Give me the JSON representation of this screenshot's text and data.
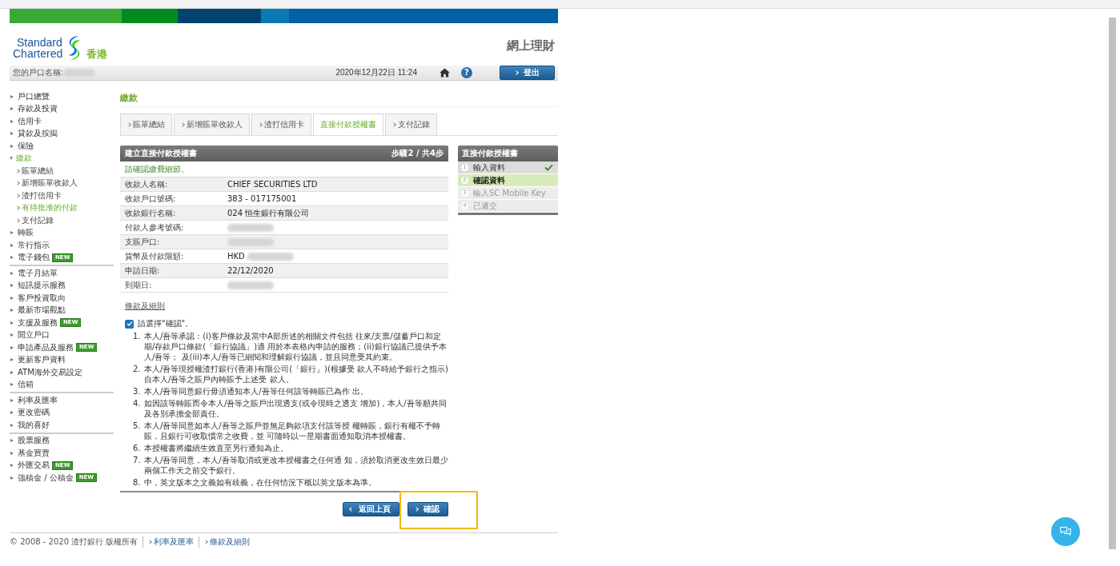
{
  "header": {
    "brand_line1": "Standard",
    "brand_line2": "Chartered",
    "region": "香港",
    "service_title": "網上理財"
  },
  "account_bar": {
    "account_label": "您的戶口名稱:",
    "datetime": "2020年12月22日 11:24",
    "help": "?",
    "logout": "登出"
  },
  "sidebar": {
    "groups": [
      {
        "items": [
          {
            "label": "戶口總覽",
            "selected": false,
            "expanded": false
          },
          {
            "label": "存款及投資",
            "selected": false,
            "expanded": false
          },
          {
            "label": "信用卡",
            "selected": false,
            "expanded": false
          },
          {
            "label": "貸款及按揭",
            "selected": false,
            "expanded": false
          },
          {
            "label": "保險",
            "selected": false,
            "expanded": false
          },
          {
            "label": "繳款",
            "selected": true,
            "expanded": true,
            "children": [
              {
                "label": "賬單總結",
                "selected": false
              },
              {
                "label": "新增賬單收款人",
                "selected": false
              },
              {
                "label": "渣打信用卡",
                "selected": false
              },
              {
                "label": "有待批准的付款",
                "selected": true
              },
              {
                "label": "支付記錄",
                "selected": false
              }
            ]
          },
          {
            "label": "轉賬",
            "selected": false,
            "expanded": false
          },
          {
            "label": "常行指示",
            "selected": false,
            "expanded": false
          },
          {
            "label": "電子錢包",
            "selected": false,
            "expanded": false,
            "badge": "NEW"
          }
        ]
      },
      {
        "items": [
          {
            "label": "電子月結單",
            "selected": false,
            "expanded": false
          },
          {
            "label": "短訊提示服務",
            "selected": false,
            "expanded": false
          },
          {
            "label": "客戶投資取向",
            "selected": false,
            "expanded": false
          },
          {
            "label": "最新市場觀點",
            "selected": false,
            "expanded": false
          },
          {
            "label": "支援及服務",
            "selected": false,
            "expanded": false,
            "badge": "NEW"
          },
          {
            "label": "開立戶口",
            "selected": false,
            "expanded": false
          },
          {
            "label": "申請產品及服務",
            "selected": false,
            "expanded": false,
            "badge": "NEW"
          },
          {
            "label": "更新客戶資料",
            "selected": false,
            "expanded": false
          },
          {
            "label": "ATM海外交易設定",
            "selected": false,
            "expanded": false
          },
          {
            "label": "信箱",
            "selected": false,
            "expanded": false
          }
        ]
      },
      {
        "items": [
          {
            "label": "利率及匯率",
            "selected": false,
            "expanded": false
          },
          {
            "label": "更改密碼",
            "selected": false,
            "expanded": false
          },
          {
            "label": "我的喜好",
            "selected": false,
            "expanded": false
          }
        ]
      },
      {
        "items": [
          {
            "label": "股票服務",
            "selected": false,
            "expanded": false
          },
          {
            "label": "基金買賣",
            "selected": false,
            "expanded": false
          },
          {
            "label": "外匯交易",
            "selected": false,
            "expanded": false,
            "badge": "NEW"
          },
          {
            "label": "強積金 / 公積金",
            "selected": false,
            "expanded": false,
            "badge": "NEW"
          }
        ]
      }
    ]
  },
  "page_title": "繳款",
  "tabs": [
    {
      "label": "賬單總結",
      "selected": false
    },
    {
      "label": "新增賬單收款人",
      "selected": false
    },
    {
      "label": "渣打信用卡",
      "selected": false
    },
    {
      "label": "直接付款授權書",
      "selected": true
    },
    {
      "label": "支付記錄",
      "selected": false
    }
  ],
  "details": {
    "title": "建立直接付款授權書",
    "step": "步驟2 / 共4步",
    "prompt": "請確認繳費細節。",
    "rows": [
      {
        "label": "收款人名稱:",
        "value": "CHIEF SECURITIES LTD",
        "redacted": false
      },
      {
        "label": "收款戶口號碼:",
        "value": "383 - 017175001",
        "redacted": false
      },
      {
        "label": "收款銀行名稱:",
        "value": "024 恒生銀行有限公司",
        "redacted": false
      },
      {
        "label": "付款人參考號碼:",
        "redacted": true
      },
      {
        "label": "支賬戶口:",
        "redacted": true
      },
      {
        "label": "貨幣及付款限額:",
        "value": "HKD",
        "redacted": true
      },
      {
        "label": "申請日期:",
        "value": "22/12/2020",
        "redacted": false
      },
      {
        "label": "到期日:",
        "redacted": true
      }
    ]
  },
  "steps_panel": {
    "title": "直接付款授權書",
    "steps": [
      {
        "number": "1",
        "label": "輸入資料",
        "checked": true,
        "selected": false,
        "disabled": false
      },
      {
        "number": "2",
        "label": "確認資料",
        "checked": false,
        "selected": true,
        "disabled": false
      },
      {
        "number": "3",
        "label": "輸入SC Mobile Key",
        "checked": false,
        "selected": false,
        "disabled": true
      },
      {
        "number": "4",
        "label": "已遞交",
        "checked": false,
        "selected": false,
        "disabled": true
      }
    ]
  },
  "terms": {
    "heading": "條款及細則",
    "confirm_label": "請選擇\"確認\"。",
    "checked": true,
    "clauses": [
      {
        "number": "1.",
        "text": "本人/吾等承認：(i)客戶條款及當中A部所述的相關文件包括 往來/支票/儲蓄戶口和定期/存款戶口條款(「銀行協議」)適 用於本表格內申請的服務；(ii)銀行協議已提供予本人/吾等； 及(iii)本人/吾等已細閱和理解銀行協議，並且同意受其約束。"
      },
      {
        "number": "2.",
        "text": "本人/吾等現授權渣打銀行(香港)有限公司(「銀行」)(根據受 款人不時給予銀行之指示)自本人/吾等之賬戶內轉賬予上述受 款人。"
      },
      {
        "number": "3.",
        "text": "本人/吾等同意銀行毋須通知本人/吾等任何該等轉賬已為作 出。"
      },
      {
        "number": "4.",
        "text": "如因該等轉賬而令本人/吾等之賬戶出現透支(或令現時之透支 增加)，本人/吾等願共同及各別承擔全部責任。"
      },
      {
        "number": "5.",
        "text": "本人/吾等同意如本人/吾等之賬戶並無足夠款項支付該等授 權轉賬，銀行有權不予轉賬，且銀行可收取慣常之收費，並 可隨時以一星期書面通知取消本授權書。"
      },
      {
        "number": "6.",
        "text": "本授權書將繼續生效直至另行通知為止。"
      },
      {
        "number": "7.",
        "text": "本人/吾等同意，本人/吾等取消或更改本授權書之任何通 知，須於取消更改生效日最少兩個工作天之前交予銀行。"
      },
      {
        "number": "8.",
        "text": "中，英文版本之文義如有歧義，在任何情況下概以英文版本為準。"
      }
    ]
  },
  "buttons": [
    {
      "label": "返回上頁",
      "kind": "back"
    },
    {
      "label": "確認",
      "kind": "next"
    }
  ],
  "highlight": {
    "on": true
  },
  "footer": {
    "copyright": "© 2008 - 2020 渣打銀行 版權所有",
    "links": [
      "利率及匯率",
      "條款及細則"
    ]
  }
}
